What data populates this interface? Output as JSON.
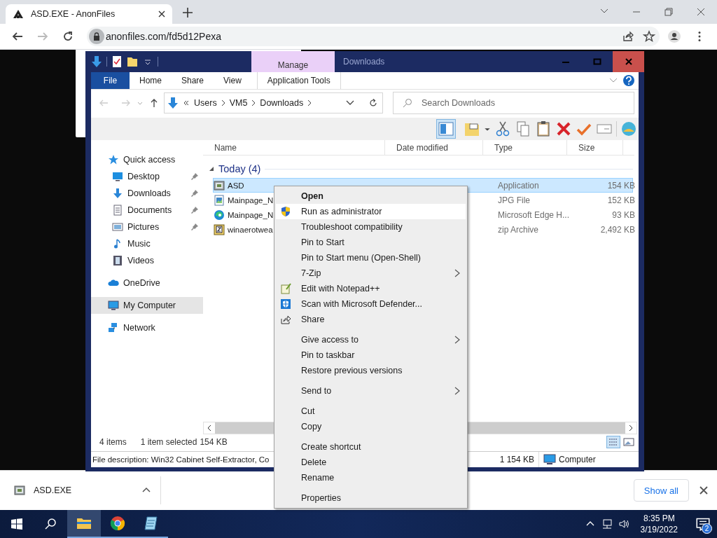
{
  "browser": {
    "tab": {
      "title": "ASD.EXE - AnonFiles"
    },
    "address": "anonfiles.com/fd5d12Pexa"
  },
  "explorer": {
    "title": "Downloads",
    "context_tab": "Manage",
    "ribbon_tabs": [
      {
        "label": "File",
        "kind": "file"
      },
      {
        "label": "Home",
        "kind": "tab"
      },
      {
        "label": "Share",
        "kind": "tab"
      },
      {
        "label": "View",
        "kind": "tab"
      },
      {
        "label": "Application Tools",
        "kind": "context"
      }
    ],
    "breadcrumb": [
      "Users",
      "VM5",
      "Downloads"
    ],
    "search": {
      "placeholder": "Search Downloads"
    },
    "nav": [
      {
        "label": "Quick access",
        "kind": "star",
        "selected": false,
        "children": [
          {
            "label": "Desktop",
            "kind": "desktop",
            "pinned": true,
            "selected": false
          },
          {
            "label": "Downloads",
            "kind": "download",
            "pinned": true,
            "selected": false
          },
          {
            "label": "Documents",
            "kind": "document",
            "pinned": true,
            "selected": false
          },
          {
            "label": "Pictures",
            "kind": "picture",
            "pinned": true,
            "selected": false
          },
          {
            "label": "Music",
            "kind": "music",
            "pinned": false,
            "selected": false
          },
          {
            "label": "Videos",
            "kind": "video",
            "pinned": false,
            "selected": false
          }
        ]
      },
      {
        "label": "OneDrive",
        "kind": "cloud",
        "selected": false
      },
      {
        "label": "My Computer",
        "kind": "computer",
        "selected": true
      },
      {
        "label": "Network",
        "kind": "network",
        "selected": false
      }
    ],
    "columns": [
      "Name",
      "Date modified",
      "Type",
      "Size"
    ],
    "group": {
      "label": "Today (4)",
      "expanded": true
    },
    "files": [
      {
        "name": "ASD",
        "kind": "exe",
        "type": "Application",
        "size": "154 KB",
        "selected": true
      },
      {
        "name": "Mainpage_N",
        "kind": "image",
        "type": "JPG File",
        "size": "152 KB",
        "selected": false
      },
      {
        "name": "Mainpage_N",
        "kind": "edge",
        "type": "Microsoft Edge H...",
        "size": "93 KB",
        "selected": false
      },
      {
        "name": "winaerotwea",
        "kind": "zip",
        "type": "zip Archive",
        "size": "2,492 KB",
        "selected": false
      }
    ],
    "status": {
      "count": "4 items",
      "selection": "1 item selected",
      "size": "154 KB"
    },
    "status_bar": {
      "description": "File description: Win32 Cabinet Self-Extractor, Co",
      "size": "1 154 KB",
      "location": "Computer"
    }
  },
  "context_menu": [
    {
      "kind": "plain",
      "label": "Open",
      "default": true,
      "selected": false,
      "submenu": false
    },
    {
      "kind": "shield",
      "label": "Run as administrator",
      "default": false,
      "selected": true,
      "submenu": false
    },
    {
      "kind": "plain",
      "label": "Troubleshoot compatibility",
      "default": false,
      "selected": false,
      "submenu": false
    },
    {
      "kind": "plain",
      "label": "Pin to Start",
      "default": false,
      "selected": false,
      "submenu": false
    },
    {
      "kind": "plain",
      "label": "Pin to Start menu (Open-Shell)",
      "default": false,
      "selected": false,
      "submenu": false
    },
    {
      "kind": "plain",
      "label": "7-Zip",
      "default": false,
      "selected": false,
      "submenu": true
    },
    {
      "kind": "notepad",
      "label": "Edit with Notepad++",
      "default": false,
      "selected": false,
      "submenu": false
    },
    {
      "kind": "defender",
      "label": "Scan with Microsoft Defender...",
      "default": false,
      "selected": false,
      "submenu": false
    },
    {
      "kind": "share",
      "label": "Share",
      "default": false,
      "selected": false,
      "submenu": false
    },
    {
      "kind": "separator"
    },
    {
      "kind": "plain",
      "label": "Give access to",
      "default": false,
      "selected": false,
      "submenu": true
    },
    {
      "kind": "plain",
      "label": "Pin to taskbar",
      "default": false,
      "selected": false,
      "submenu": false
    },
    {
      "kind": "plain",
      "label": "Restore previous versions",
      "default": false,
      "selected": false,
      "submenu": false
    },
    {
      "kind": "separator"
    },
    {
      "kind": "plain",
      "label": "Send to",
      "default": false,
      "selected": false,
      "submenu": true
    },
    {
      "kind": "separator"
    },
    {
      "kind": "plain",
      "label": "Cut",
      "default": false,
      "selected": false,
      "submenu": false
    },
    {
      "kind": "plain",
      "label": "Copy",
      "default": false,
      "selected": false,
      "submenu": false
    },
    {
      "kind": "separator"
    },
    {
      "kind": "plain",
      "label": "Create shortcut",
      "default": false,
      "selected": false,
      "submenu": false
    },
    {
      "kind": "plain",
      "label": "Delete",
      "default": false,
      "selected": false,
      "submenu": false
    },
    {
      "kind": "plain",
      "label": "Rename",
      "default": false,
      "selected": false,
      "submenu": false
    },
    {
      "kind": "separator"
    },
    {
      "kind": "plain",
      "label": "Properties",
      "default": false,
      "selected": false,
      "submenu": false
    }
  ],
  "download_bar": {
    "file": "ASD.EXE",
    "button": "Show all"
  },
  "taskbar": {
    "apps": [
      {
        "kind": "explorer",
        "selected": true
      },
      {
        "kind": "chrome",
        "selected": false
      },
      {
        "kind": "notepad",
        "selected": false
      }
    ],
    "time": "8:35 PM",
    "date": "3/19/2022",
    "notifications": "2"
  }
}
